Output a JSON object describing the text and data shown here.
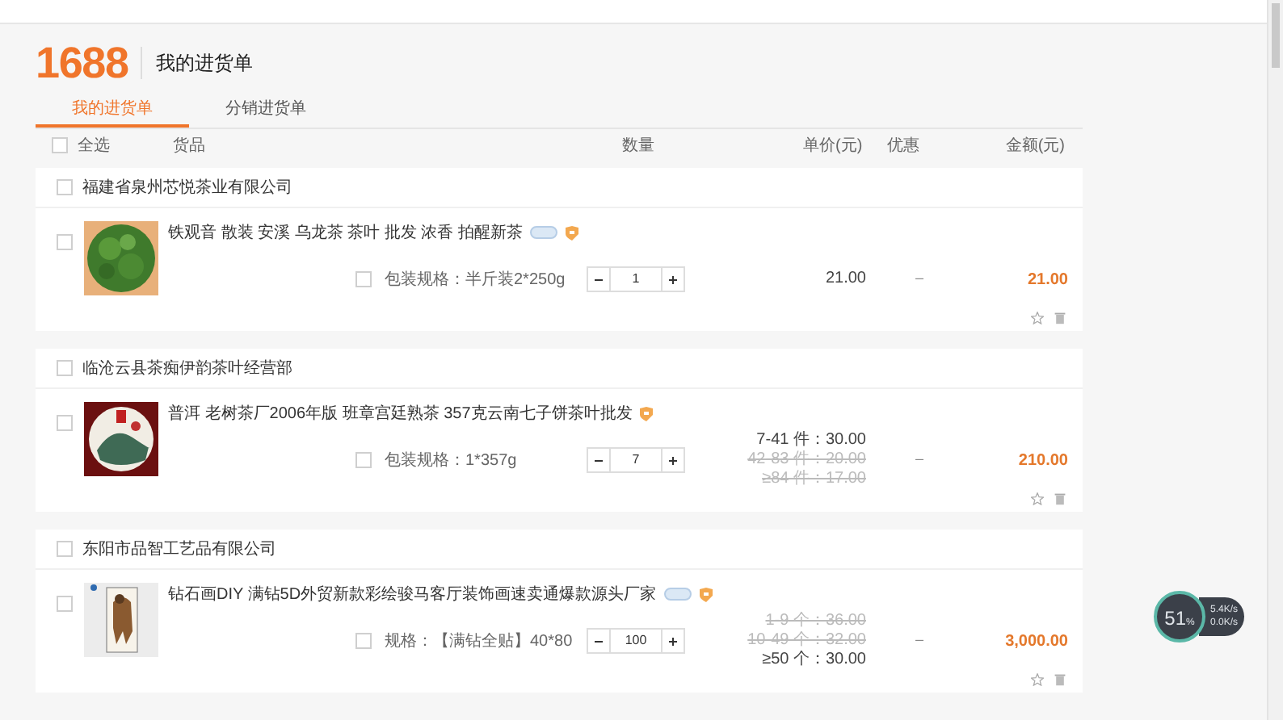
{
  "header": {
    "logo": "1688",
    "title": "我的进货单"
  },
  "tabs": [
    {
      "label": "我的进货单",
      "selected": true
    },
    {
      "label": "分销进货单",
      "selected": false
    }
  ],
  "columns": {
    "select_all": "全选",
    "checked": false,
    "product": "货品",
    "quantity": "数量",
    "unit_price": "单价(元)",
    "discount": "优惠",
    "amount": "金额(元)"
  },
  "shops": [
    {
      "name": "福建省泉州芯悦茶业有限公司",
      "checked": false,
      "items": [
        {
          "title": "铁观音 散装 安溪 乌龙茶 茶叶 批发 浓香 拍醒新茶",
          "has_tag": true,
          "checked": false,
          "spec": "包装规格：半斤装2*250g",
          "spec_checked": false,
          "quantity": "1",
          "prices": [
            {
              "text": "21.00",
              "active": true
            }
          ],
          "discount": "–",
          "amount": "21.00"
        }
      ]
    },
    {
      "name": "临沧云县茶痴伊韵茶叶经营部",
      "checked": false,
      "items": [
        {
          "title": "普洱 老树茶厂2006年版 班章宫廷熟茶 357克云南七子饼茶叶批发",
          "has_tag": false,
          "checked": false,
          "spec": "包装规格：1*357g",
          "spec_checked": false,
          "quantity": "7",
          "prices": [
            {
              "text": "7-41 件：30.00",
              "active": true
            },
            {
              "text": "42-83 件：20.00",
              "active": false
            },
            {
              "text": "≥84 件：17.00",
              "active": false
            }
          ],
          "discount": "–",
          "amount": "210.00"
        }
      ]
    },
    {
      "name": "东阳市品智工艺品有限公司",
      "checked": false,
      "items": [
        {
          "title": "钻石画DIY 满钻5D外贸新款彩绘骏马客厅装饰画速卖通爆款源头厂家",
          "has_tag": true,
          "checked": false,
          "spec": "规格：【满钻全贴】40*80",
          "spec_checked": false,
          "quantity": "100",
          "prices": [
            {
              "text": "1-9 个：36.00",
              "active": false
            },
            {
              "text": "10-49 个：32.00",
              "active": false
            },
            {
              "text": "≥50 个：30.00",
              "active": true
            }
          ],
          "discount": "–",
          "amount": "3,000.00"
        }
      ]
    }
  ],
  "speed_widget": {
    "percent": "51",
    "unit": "%",
    "upload": "5.4K/s",
    "download": "0.0K/s"
  }
}
